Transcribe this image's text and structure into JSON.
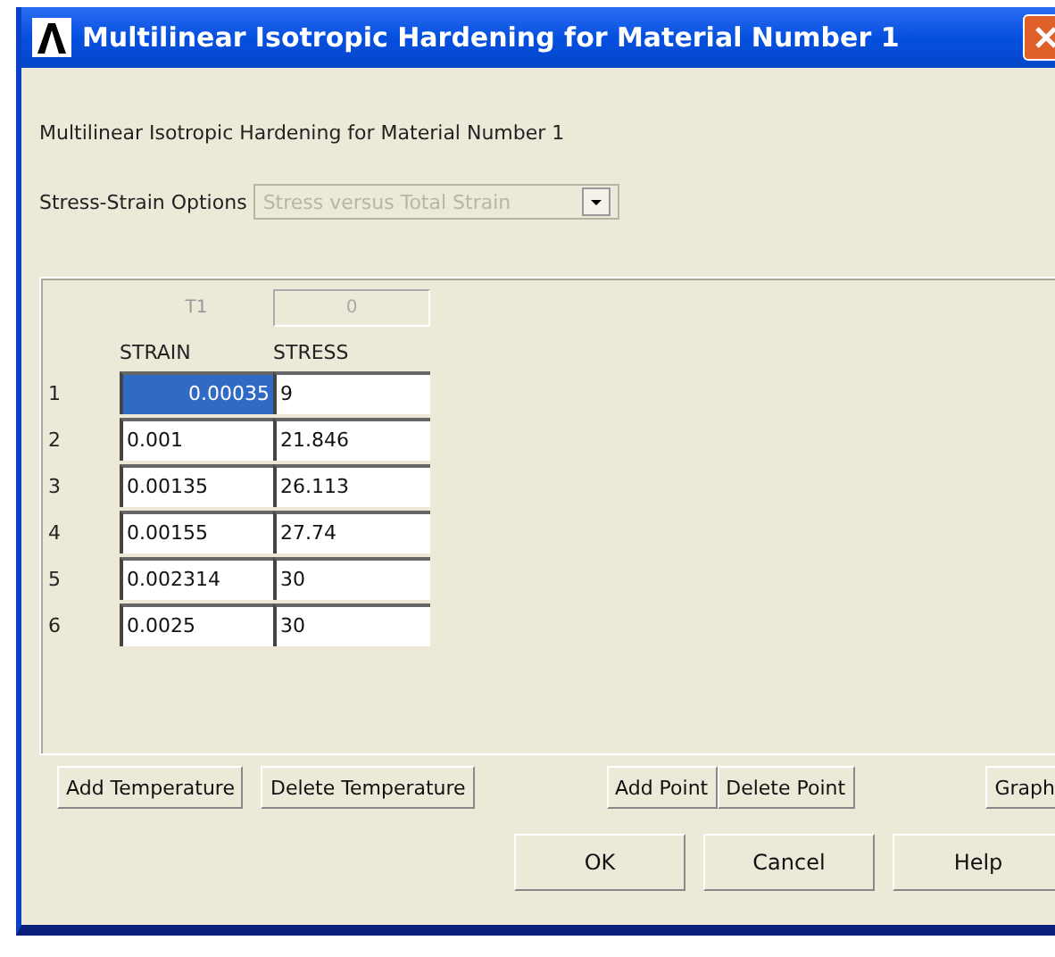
{
  "window": {
    "title": "Multilinear Isotropic Hardening for Material Number 1"
  },
  "heading": "Multilinear Isotropic Hardening for Material Number 1",
  "options": {
    "label": "Stress-Strain Options",
    "value": "Stress versus Total Strain",
    "disabled": true
  },
  "table": {
    "temperature_label": "T1",
    "temperature_value": "0",
    "columns": [
      "STRAIN",
      "STRESS"
    ],
    "rows": [
      {
        "index": "1",
        "cells": [
          {
            "value": "0.00035",
            "selected": true
          },
          {
            "value": "9",
            "selected": false
          }
        ]
      },
      {
        "index": "2",
        "cells": [
          {
            "value": "0.001",
            "selected": false
          },
          {
            "value": "21.846",
            "selected": false
          }
        ]
      },
      {
        "index": "3",
        "cells": [
          {
            "value": "0.00135",
            "selected": false
          },
          {
            "value": "26.113",
            "selected": false
          }
        ]
      },
      {
        "index": "4",
        "cells": [
          {
            "value": "0.00155",
            "selected": false
          },
          {
            "value": "27.74",
            "selected": false
          }
        ]
      },
      {
        "index": "5",
        "cells": [
          {
            "value": "0.002314",
            "selected": false
          },
          {
            "value": "30",
            "selected": false
          }
        ]
      },
      {
        "index": "6",
        "cells": [
          {
            "value": "0.0025",
            "selected": false
          },
          {
            "value": "30",
            "selected": false
          }
        ]
      }
    ]
  },
  "table_buttons": [
    "Add Temperature",
    "Delete Temperature",
    "Add Point",
    "Delete Point",
    "Graph"
  ],
  "dialog_buttons": [
    "OK",
    "Cancel",
    "Help"
  ]
}
